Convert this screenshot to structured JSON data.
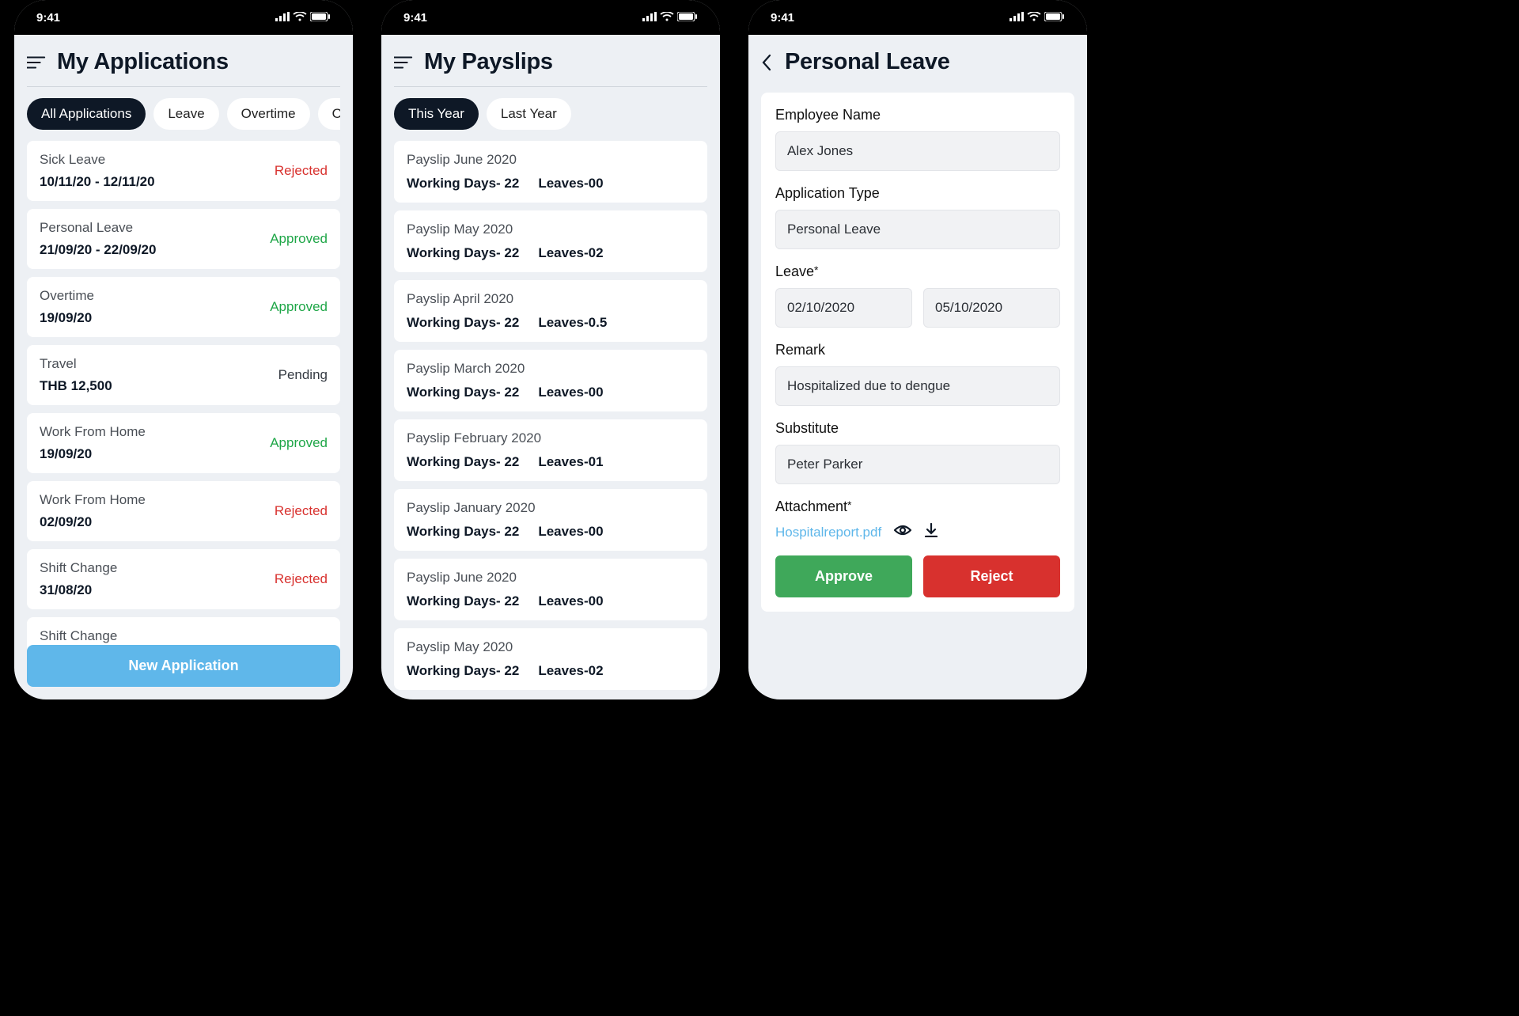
{
  "statusbar": {
    "time": "9:41"
  },
  "screen1": {
    "title": "My Applications",
    "new_application": "New Application",
    "chips": [
      "All Applications",
      "Leave",
      "Overtime",
      "O"
    ],
    "apps": [
      {
        "type": "Sick Leave",
        "sub": "10/11/20 - 12/11/20",
        "status": "Rejected",
        "cls": "status-rejected"
      },
      {
        "type": "Personal Leave",
        "sub": "21/09/20 - 22/09/20",
        "status": "Approved",
        "cls": "status-approved"
      },
      {
        "type": "Overtime",
        "sub": "19/09/20",
        "status": "Approved",
        "cls": "status-approved"
      },
      {
        "type": "Travel",
        "sub": "THB 12,500",
        "status": "Pending",
        "cls": "status-pending"
      },
      {
        "type": "Work From Home",
        "sub": "19/09/20",
        "status": "Approved",
        "cls": "status-approved"
      },
      {
        "type": "Work From Home",
        "sub": "02/09/20",
        "status": "Rejected",
        "cls": "status-rejected"
      },
      {
        "type": "Shift Change",
        "sub": "31/08/20",
        "status": "Rejected",
        "cls": "status-rejected"
      },
      {
        "type": "Shift Change",
        "sub": "",
        "status": "",
        "cls": ""
      }
    ]
  },
  "screen2": {
    "title": "My Payslips",
    "chips": [
      "This Year",
      "Last Year"
    ],
    "payslips": [
      {
        "title": "Payslip June 2020",
        "working": "Working Days- 22",
        "leaves": "Leaves-00"
      },
      {
        "title": "Payslip May 2020",
        "working": "Working Days- 22",
        "leaves": "Leaves-02"
      },
      {
        "title": "Payslip April 2020",
        "working": "Working Days- 22",
        "leaves": "Leaves-0.5"
      },
      {
        "title": "Payslip March 2020",
        "working": "Working Days- 22",
        "leaves": "Leaves-00"
      },
      {
        "title": "Payslip February 2020",
        "working": "Working Days- 22",
        "leaves": "Leaves-01"
      },
      {
        "title": "Payslip January 2020",
        "working": "Working Days- 22",
        "leaves": "Leaves-00"
      },
      {
        "title": "Payslip June 2020",
        "working": "Working Days- 22",
        "leaves": "Leaves-00"
      },
      {
        "title": "Payslip May 2020",
        "working": "Working Days- 22",
        "leaves": "Leaves-02"
      }
    ]
  },
  "screen3": {
    "title": "Personal Leave",
    "labels": {
      "employee": "Employee Name",
      "apptype": "Application Type",
      "leave": "Leave",
      "remark": "Remark",
      "substitute": "Substitute",
      "attachment": "Attachment"
    },
    "values": {
      "employee": "Alex Jones",
      "apptype": "Personal Leave",
      "from": "02/10/2020",
      "to": "05/10/2020",
      "remark": "Hospitalized due to dengue",
      "substitute": "Peter Parker",
      "attachment": "Hospitalreport.pdf"
    },
    "buttons": {
      "approve": "Approve",
      "reject": "Reject"
    }
  }
}
